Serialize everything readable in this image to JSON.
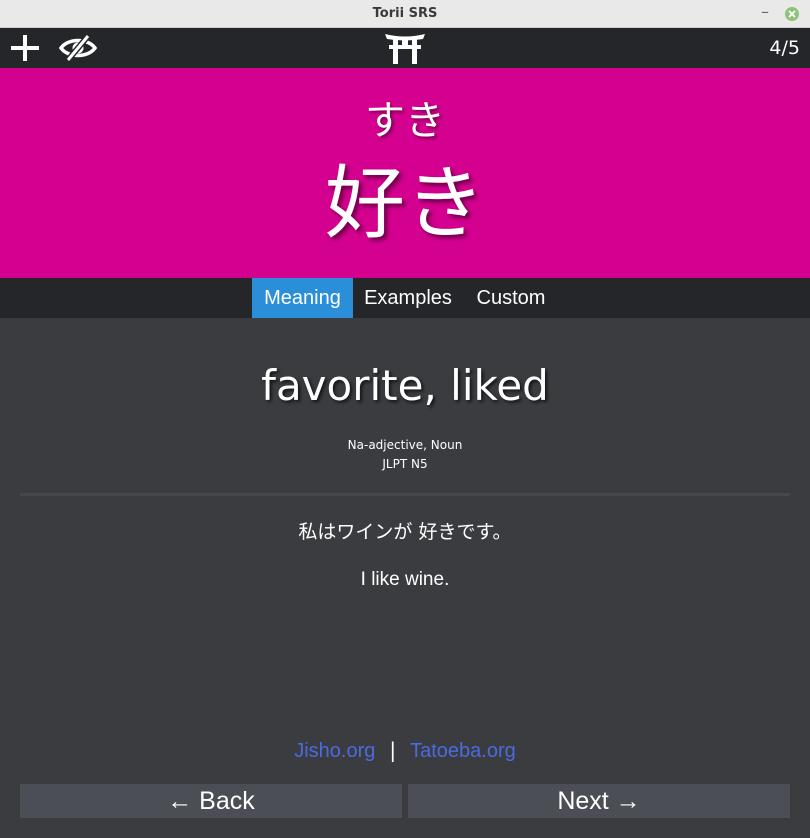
{
  "window": {
    "title": "Torii SRS",
    "minimize_glyph": "–"
  },
  "toolbar": {
    "add_icon": "plus-icon",
    "hide_icon": "eye-slash-icon",
    "logo_icon": "torii-gate-icon",
    "counter": "4/5"
  },
  "card": {
    "reading": "すき",
    "word": "好き",
    "background_color": "#d4008f"
  },
  "tabs": [
    {
      "label": "Meaning",
      "active": true
    },
    {
      "label": "Examples",
      "active": false
    },
    {
      "label": "Custom",
      "active": false
    }
  ],
  "meaning": {
    "text": "favorite, liked",
    "part_of_speech": "Na-adjective, Noun",
    "level": "JLPT N5"
  },
  "example": {
    "japanese": "私はワインが 好きです。",
    "english": "I like wine."
  },
  "links": {
    "jisho": "Jisho.org",
    "separator": "|",
    "tatoeba": "Tatoeba.org"
  },
  "navigation": {
    "back_label": "← Back",
    "next_label": "Next →"
  }
}
